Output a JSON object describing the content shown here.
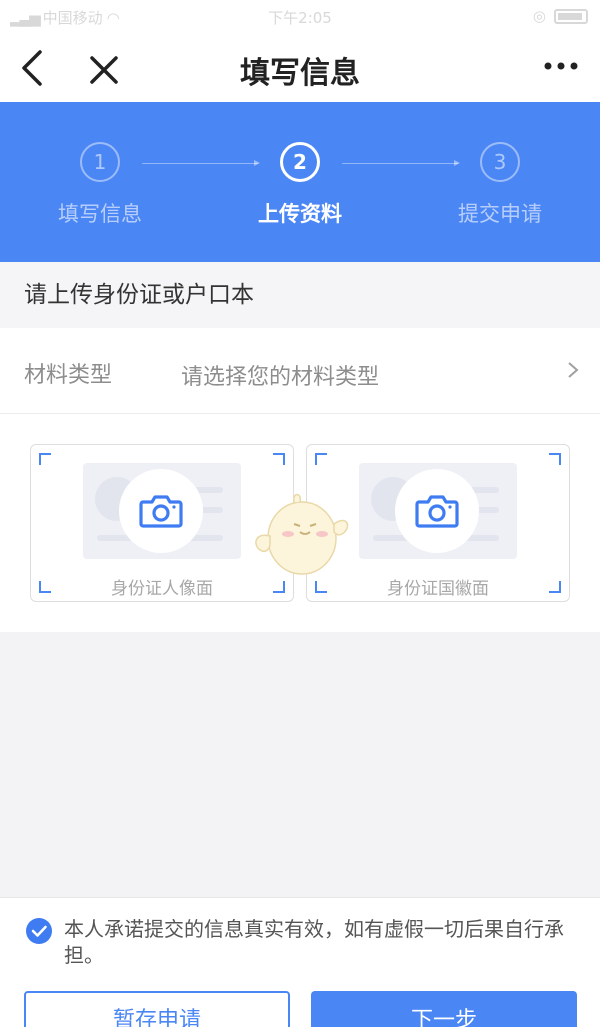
{
  "status_bar": {
    "carrier": "中国移动",
    "time": "下午2:05"
  },
  "nav": {
    "title": "填写信息",
    "back_icon": "chevron-left-icon",
    "close_icon": "close-icon",
    "more_icon": "more-dots-icon"
  },
  "stepper": {
    "steps": [
      {
        "number": "1",
        "label": "填写信息",
        "active": false
      },
      {
        "number": "2",
        "label": "上传资料",
        "active": true
      },
      {
        "number": "3",
        "label": "提交申请",
        "active": false
      }
    ]
  },
  "section": {
    "heading": "请上传身份证或户口本"
  },
  "material_type": {
    "label": "材料类型",
    "placeholder": "请选择您的材料类型"
  },
  "uploads": [
    {
      "caption": "身份证人像面",
      "icon": "camera-icon"
    },
    {
      "caption": "身份证国徽面",
      "icon": "camera-icon"
    }
  ],
  "footer": {
    "agreement": "本人承诺提交的信息真实有效，如有虚假一切后果自行承担。",
    "agreement_checked": true,
    "save_button": "暂存申请",
    "next_button": "下一步"
  },
  "colors": {
    "accent": "#4b86f5",
    "background": "#f3f3f5"
  }
}
